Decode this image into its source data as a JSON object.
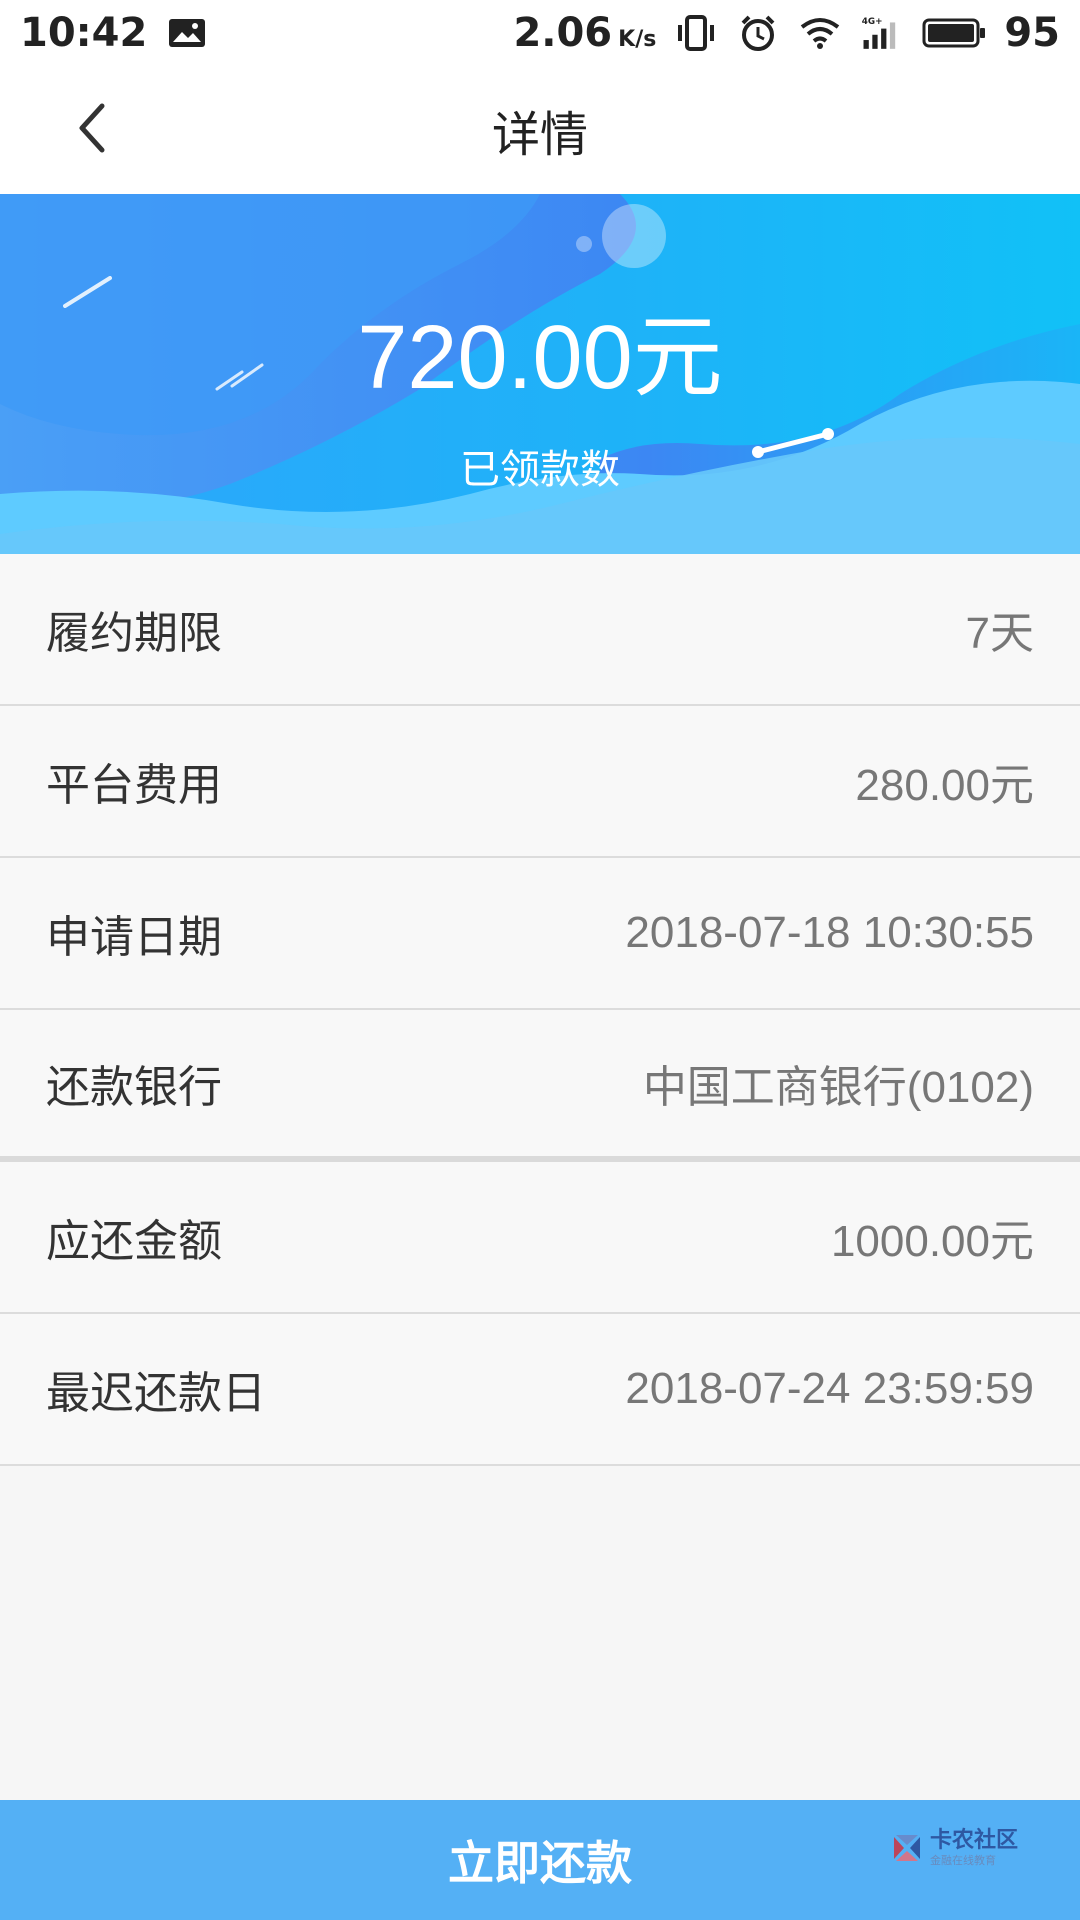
{
  "status_bar": {
    "time": "10:42",
    "net_speed": "2.06",
    "net_unit": "K/s",
    "battery": "95",
    "icons": [
      "image-icon",
      "vibrate-icon",
      "alarm-icon",
      "wifi-icon",
      "signal-4g-icon",
      "battery-icon"
    ]
  },
  "nav": {
    "title": "详情",
    "back_icon": "chevron-left-icon"
  },
  "banner": {
    "amount": "720.00元",
    "label": "已领款数",
    "colors": [
      "#4aa8f8",
      "#2f8cf2",
      "#63c5ff"
    ]
  },
  "details": [
    {
      "label": "履约期限",
      "value": "7天"
    },
    {
      "label": "平台费用",
      "value": "280.00元"
    },
    {
      "label": "申请日期",
      "value": "2018-07-18 10:30:55"
    },
    {
      "label": "还款银行",
      "value": "中国工商银行(0102)"
    },
    {
      "label": "应还金额",
      "value": "1000.00元"
    },
    {
      "label": "最迟还款日",
      "value": "2018-07-24 23:59:59"
    }
  ],
  "action": {
    "label": "立即还款",
    "color": "#54b0f5"
  },
  "watermark": {
    "title": "卡农社区",
    "subtitle": "金融在线教育"
  }
}
